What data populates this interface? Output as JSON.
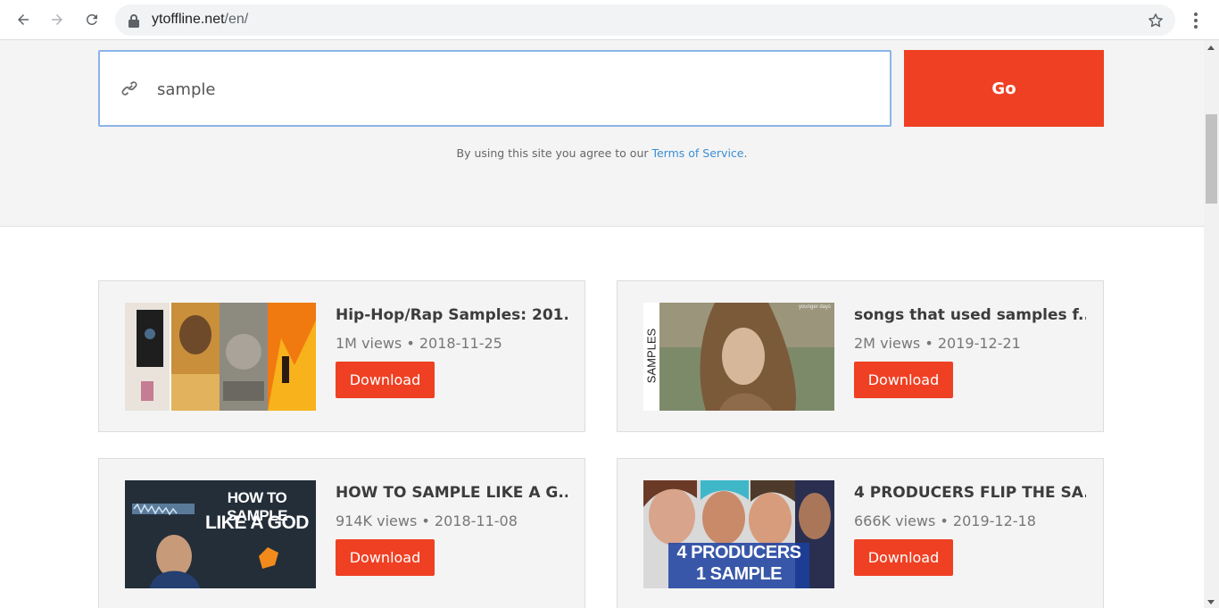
{
  "browser": {
    "url_domain": "ytoffline.net",
    "url_path": "/en/"
  },
  "search": {
    "value": "sample",
    "go_label": "Go"
  },
  "terms": {
    "prefix": "By using this site you agree to our ",
    "link": "Terms of Service",
    "suffix": "."
  },
  "results": [
    {
      "title": "Hip-Hop/Rap Samples: 201...",
      "meta": "1M views • 2018-11-25",
      "button": "Download"
    },
    {
      "title": "songs that used samples f...",
      "meta": "2M views • 2019-12-21",
      "button": "Download",
      "thumb_side_text": "SAMPLES",
      "thumb_corner_text": "younger days"
    },
    {
      "title": "HOW TO SAMPLE LIKE A G...",
      "meta": "914K views • 2018-11-08",
      "button": "Download",
      "thumb_text_1": "HOW TO SAMPLE",
      "thumb_text_2": "LIKE A GOD"
    },
    {
      "title": "4 PRODUCERS FLIP THE SA...",
      "meta": "666K views • 2019-12-18",
      "button": "Download",
      "thumb_text_1": "4 PRODUCERS",
      "thumb_text_2": "1 SAMPLE"
    }
  ],
  "colors": {
    "accent": "#ef4023",
    "link": "#3a8fd6",
    "hero_bg": "#f4f4f4"
  },
  "icons": {
    "back": "back-arrow-icon",
    "forward": "forward-arrow-icon",
    "reload": "reload-icon",
    "lock": "lock-icon",
    "bookmark": "star-icon",
    "menu": "more-vert-icon",
    "search": "link-icon"
  }
}
